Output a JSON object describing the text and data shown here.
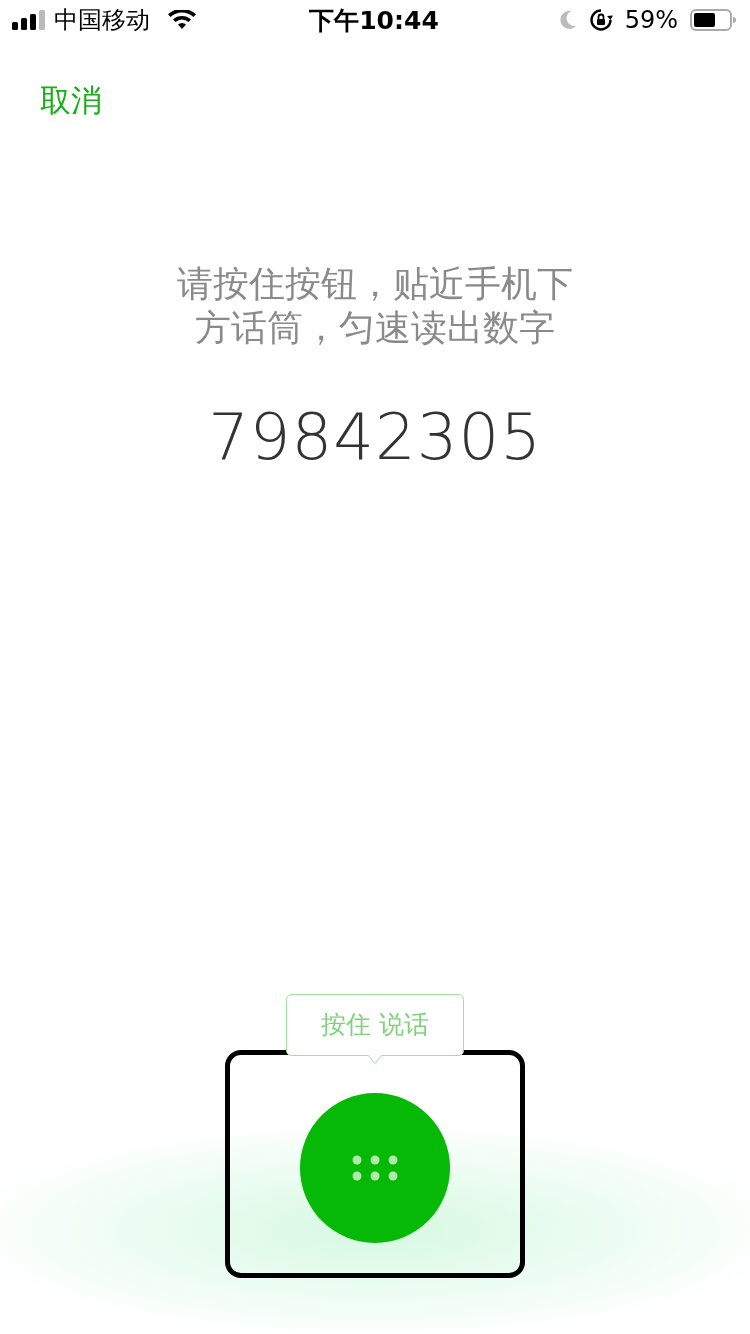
{
  "status_bar": {
    "carrier": "中国移动",
    "time": "下午10:44",
    "battery": "59%"
  },
  "cancel": "取消",
  "prompt": "请按住按钮，贴近手机下方话筒，匀速读出数字",
  "code": "79842305",
  "hold_hint": "按住 说话",
  "annotation": {
    "kind": "frame"
  }
}
